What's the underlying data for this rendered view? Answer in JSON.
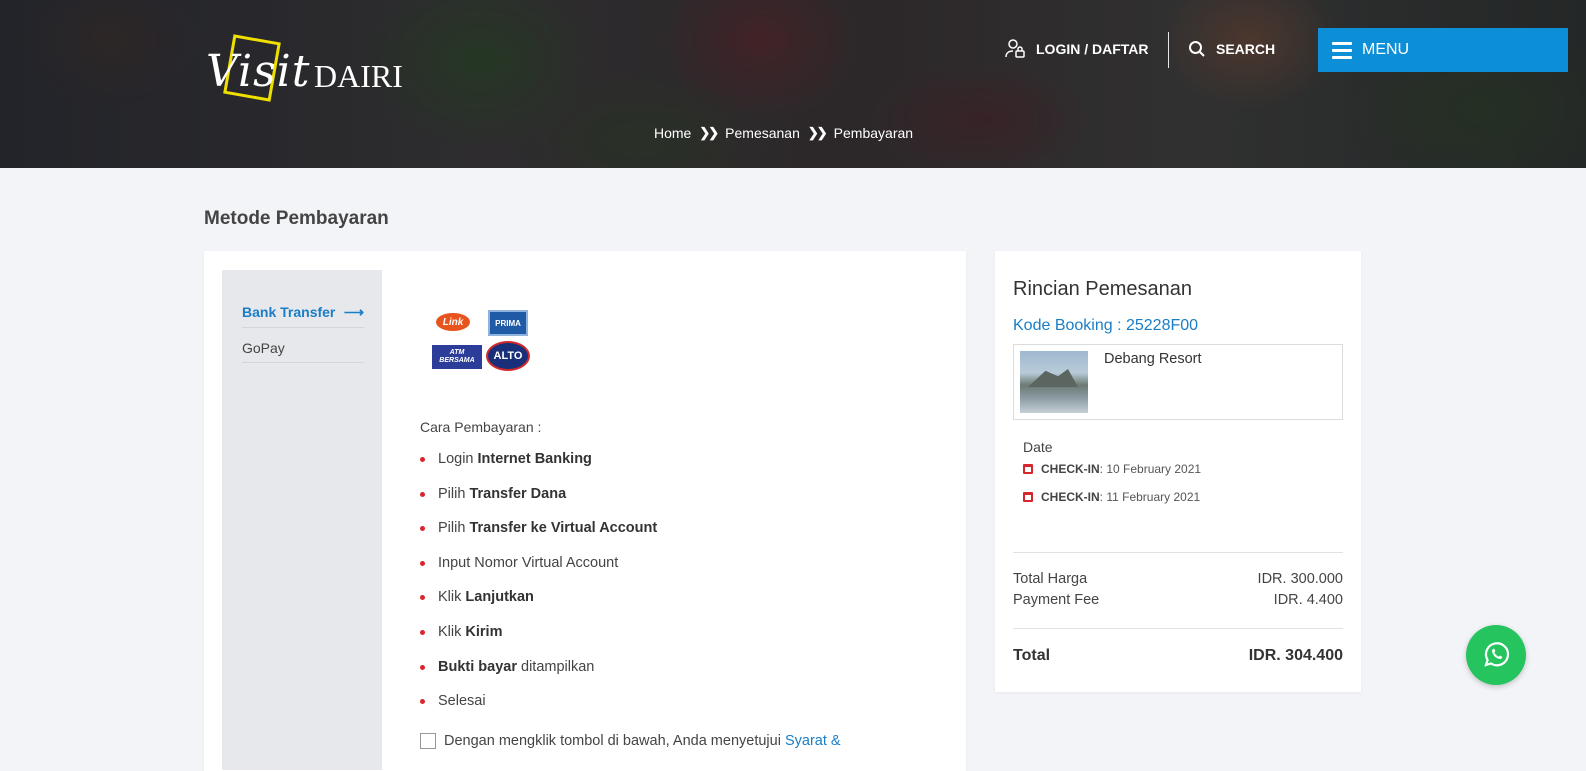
{
  "header": {
    "logo_text_visit": "Visit",
    "logo_text_dairi": "DAIRI",
    "login_label": "LOGIN / DAFTAR",
    "search_label": "SEARCH",
    "menu_label": "MENU",
    "breadcrumb": [
      "Home",
      "Pemesanan",
      "Pembayaran"
    ]
  },
  "page": {
    "title": "Metode Pembayaran"
  },
  "payment_methods": {
    "items": [
      {
        "label": "Bank Transfer",
        "active": true
      },
      {
        "label": "GoPay",
        "active": false
      }
    ]
  },
  "bank_logos": [
    "Link",
    "PRIMA",
    "ATM BERSAMA",
    "ALTO"
  ],
  "instructions": {
    "title": "Cara Pembayaran :",
    "steps": [
      {
        "pre": "Login ",
        "bold": "Internet Banking",
        "post": ""
      },
      {
        "pre": "Pilih ",
        "bold": "Transfer Dana",
        "post": ""
      },
      {
        "pre": "Pilih ",
        "bold": "Transfer ke Virtual Account",
        "post": ""
      },
      {
        "pre": "Input Nomor Virtual Account",
        "bold": "",
        "post": ""
      },
      {
        "pre": "Klik ",
        "bold": "Lanjutkan",
        "post": ""
      },
      {
        "pre": "Klik ",
        "bold": "Kirim",
        "post": ""
      },
      {
        "pre": "",
        "bold": "Bukti bayar",
        "post": " ditampilkan"
      },
      {
        "pre": "Selesai",
        "bold": "",
        "post": ""
      }
    ]
  },
  "agreement": {
    "text": "Dengan mengklik tombol di bawah, Anda menyetujui ",
    "link": "Syarat &"
  },
  "summary": {
    "title": "Rincian Pemesanan",
    "booking_code": "Kode Booking : 25228F00",
    "resort_name": "Debang Resort",
    "date_label": "Date",
    "checkin_label": "CHECK-IN",
    "checkin_date": ": 10 February 2021",
    "checkout_label": "CHECK-IN",
    "checkout_date": ": 11 February 2021",
    "total_harga_label": "Total Harga",
    "total_harga_value": "IDR. 300.000",
    "payment_fee_label": "Payment Fee",
    "payment_fee_value": "IDR. 4.400",
    "total_label": "Total",
    "total_value": "IDR. 304.400"
  },
  "colors": {
    "accent": "#0d8fd8",
    "link": "#1a7ec6",
    "bullet": "#d8262f",
    "whatsapp": "#25c45e"
  }
}
